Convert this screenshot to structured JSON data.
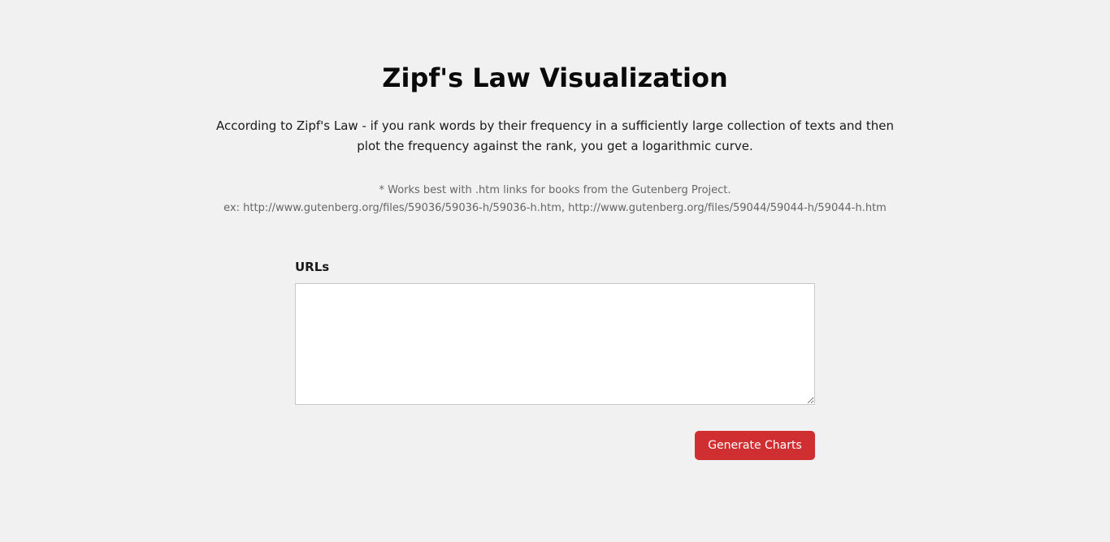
{
  "header": {
    "title": "Zipf's Law Visualization"
  },
  "intro": {
    "text": "According to Zipf's Law - if you rank words by their frequency in a sufficiently large collection of texts and then plot the frequency against the rank, you get a logarithmic curve."
  },
  "note": {
    "line1": "* Works best with .htm links for books from the Gutenberg Project.",
    "line2": "ex: http://www.gutenberg.org/files/59036/59036-h/59036-h.htm, http://www.gutenberg.org/files/59044/59044-h/59044-h.htm"
  },
  "form": {
    "urls_label": "URLs",
    "urls_value": "",
    "submit_label": "Generate Charts"
  },
  "colors": {
    "background": "#f1f1f1",
    "button": "#cf2f30",
    "button_text": "#ffffff",
    "note_text": "#666666"
  }
}
